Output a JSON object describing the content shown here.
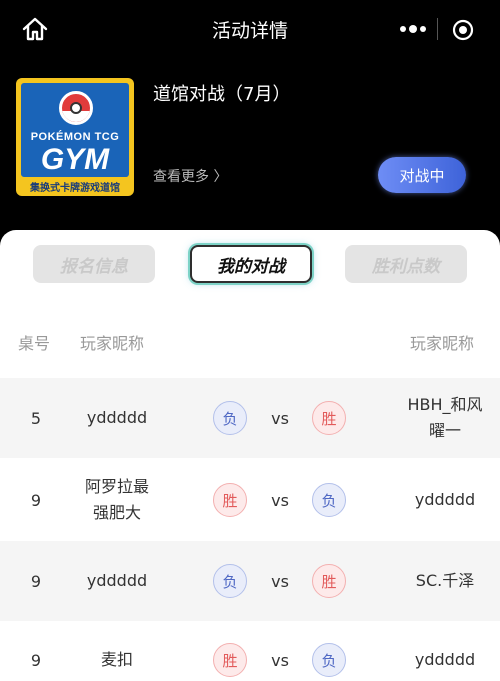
{
  "header": {
    "title": "活动详情"
  },
  "event": {
    "logo_brand": "POKÉMON TCG",
    "logo_gym": "GYM",
    "logo_sub": "集换式卡牌游戏道馆",
    "name": "道馆对战（7月）",
    "see_more": "查看更多 〉",
    "status": "对战中"
  },
  "tabs": [
    {
      "label": "报名信息"
    },
    {
      "label": "我的对战"
    },
    {
      "label": "胜利点数"
    }
  ],
  "columns": {
    "table": "桌号",
    "player1": "玩家昵称",
    "player2": "玩家昵称"
  },
  "vs_label": "vs",
  "matches": [
    {
      "table": "5",
      "player1": "yddddd",
      "result1": "负",
      "result2": "胜",
      "player2": "HBH_和风\n曜一"
    },
    {
      "table": "9",
      "player1": "阿罗拉最\n强肥大",
      "result1": "胜",
      "result2": "负",
      "player2": "yddddd"
    },
    {
      "table": "9",
      "player1": "yddddd",
      "result1": "负",
      "result2": "胜",
      "player2": "SC.千泽"
    },
    {
      "table": "9",
      "player1": "麦扣",
      "result1": "胜",
      "result2": "负",
      "player2": "yddddd"
    }
  ]
}
